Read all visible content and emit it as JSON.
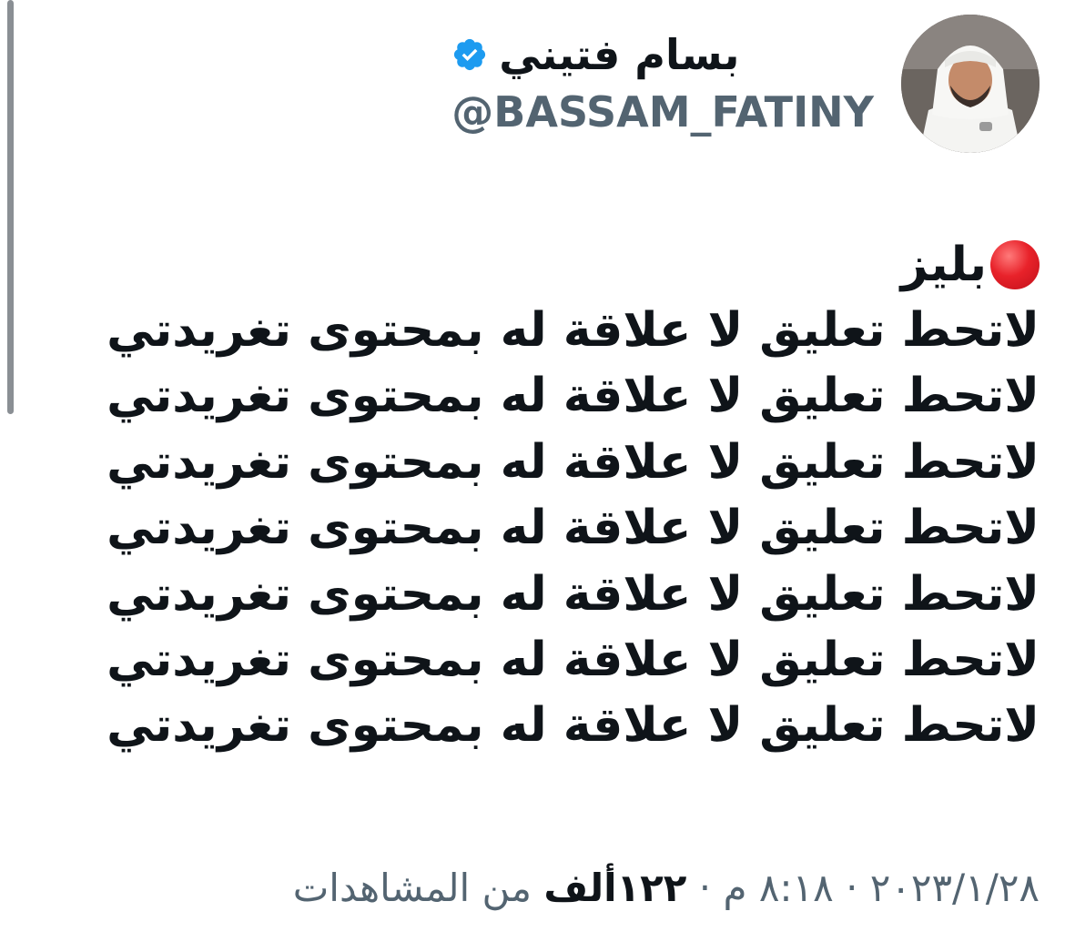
{
  "user": {
    "display_name": "بسام فتيني",
    "handle": "@BASSAM_FATINY",
    "verified": true
  },
  "tweet": {
    "first_line_text": "بليز",
    "emoji": "red-circle-icon",
    "lines": [
      "لاتحط تعليق لا علاقة له بمحتوى تغريدتي",
      "لاتحط تعليق لا علاقة له بمحتوى تغريدتي",
      "لاتحط تعليق لا علاقة له بمحتوى تغريدتي",
      "لاتحط تعليق لا علاقة له بمحتوى تغريدتي",
      "لاتحط تعليق لا علاقة له بمحتوى تغريدتي",
      "لاتحط تعليق لا علاقة له بمحتوى تغريدتي",
      "لاتحط تعليق لا علاقة له بمحتوى تغريدتي"
    ]
  },
  "meta": {
    "date": "٢٠٢٣/١/٢٨",
    "separator": "·",
    "time": "٨:١٨ م",
    "views_count": "١٢٢ألف",
    "views_label": "من المشاهدات"
  },
  "colors": {
    "text": "#0f1419",
    "secondary": "#536471",
    "verified": "#1d9bf0",
    "emoji_red": "#e8222a"
  }
}
